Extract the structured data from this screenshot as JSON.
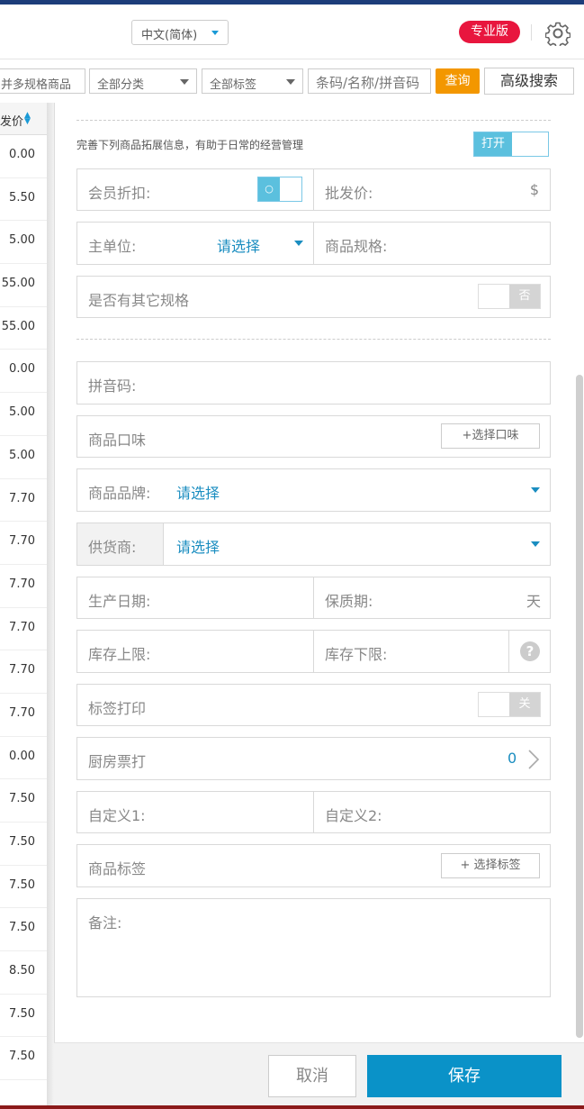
{
  "header": {
    "language": "中文(简体)",
    "edition_badge": "专业版",
    "settings_icon": "gear-icon"
  },
  "toolbar": {
    "filter_multi_spec": "并多规格商品",
    "category": "全部分类",
    "tag": "全部标签",
    "search_placeholder": "条码/名称/拼音码",
    "query": "查询",
    "advanced_search": "高级搜索"
  },
  "left_column": {
    "header": "发价",
    "values": [
      "0.00",
      "5.50",
      "5.00",
      "55.00",
      "55.00",
      "0.00",
      "5.00",
      "5.00",
      "7.70",
      "7.70",
      "7.70",
      "7.70",
      "7.70",
      "7.70",
      "0.00",
      "7.50",
      "7.50",
      "7.50",
      "7.50",
      "8.50",
      "7.50",
      "7.50"
    ]
  },
  "panel": {
    "intro": "完善下列商品拓展信息，有助于日常的经营管理",
    "intro_toggle": "打开",
    "member_discount": "会员折扣:",
    "member_discount_toggle": "○",
    "wholesale_price": "批发价:",
    "wholesale_unit": "$",
    "main_unit": "主单位:",
    "main_unit_value": "请选择",
    "spec": "商品规格:",
    "other_spec": "是否有其它规格",
    "other_spec_toggle": "否",
    "pinyin": "拼音码:",
    "flavor": "商品口味",
    "flavor_btn": "+选择口味",
    "brand": "商品品牌:",
    "brand_value": "请选择",
    "supplier": "供货商:",
    "supplier_value": "请选择",
    "production_date": "生产日期:",
    "shelf_life": "保质期:",
    "shelf_life_unit": "天",
    "stock_upper": "库存上限:",
    "stock_lower": "库存下限:",
    "help_icon": "?",
    "label_print": "标签打印",
    "label_print_toggle": "关",
    "kitchen_print": "厨房票打",
    "kitchen_print_count": "0",
    "custom1": "自定义1:",
    "custom2": "自定义2:",
    "product_tags": "商品标签",
    "tags_btn": "+ 选择标签",
    "remark": "备注:"
  },
  "footer": {
    "cancel": "取消",
    "save": "保存"
  },
  "colors": {
    "accent": "#0a92c8",
    "badge": "#e8163e",
    "query": "#f39700"
  }
}
